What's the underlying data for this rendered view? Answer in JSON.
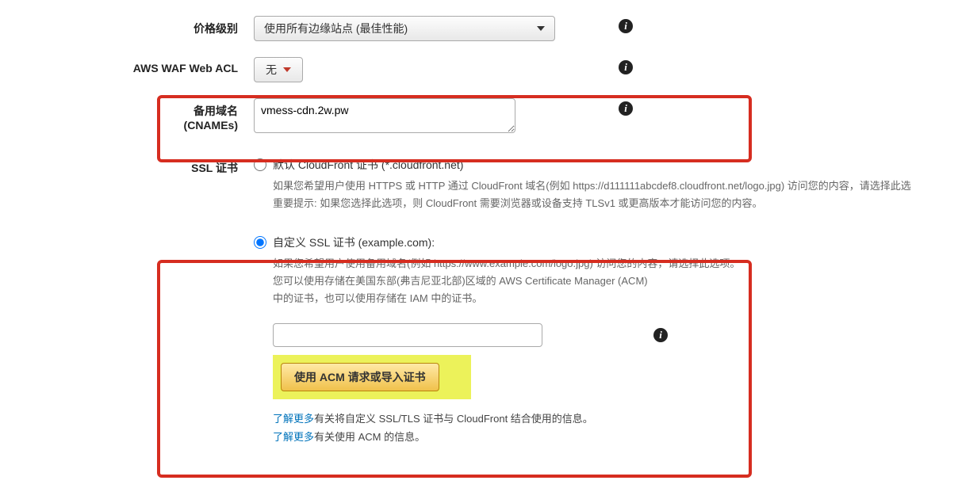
{
  "priceClass": {
    "label": "价格级别",
    "value": "使用所有边缘站点 (最佳性能)"
  },
  "waf": {
    "label": "AWS WAF Web ACL",
    "value": "无"
  },
  "cnames": {
    "label": "备用域名",
    "subLabel": "(CNAMEs)",
    "value": "vmess-cdn.2w.pw"
  },
  "ssl": {
    "label": "SSL 证书",
    "defaultOption": "默认 CloudFront 证书 (*.cloudfront.net)",
    "defaultDesc1": "如果您希望用户使用 HTTPS 或 HTTP 通过 CloudFront 域名(例如 https://d111111abcdef8.cloudfront.net/logo.jpg) 访问您的内容，请选择此选",
    "defaultDesc2": "重要提示: 如果您选择此选项，则 CloudFront 需要浏览器或设备支持 TLSv1 或更高版本才能访问您的内容。",
    "customOption": "自定义 SSL 证书 (example.com):",
    "customDesc1": "如果您希望用户使用备用域名(例如 https://www.example.com/logo.jpg) 访问您的内容，请选择此选项。",
    "customDesc2": "您可以使用存储在美国东部(弗吉尼亚北部)区域的 AWS Certificate Manager (ACM)",
    "customDesc3": "中的证书，也可以使用存储在 IAM 中的证书。",
    "certInputValue": "",
    "acmButton": "使用 ACM 请求或导入证书",
    "learnMore": "了解更多",
    "learnMoreText1": "有关将自定义 SSL/TLS 证书与 CloudFront 结合使用的信息。",
    "learnMoreText2": "有关使用 ACM 的信息。"
  }
}
